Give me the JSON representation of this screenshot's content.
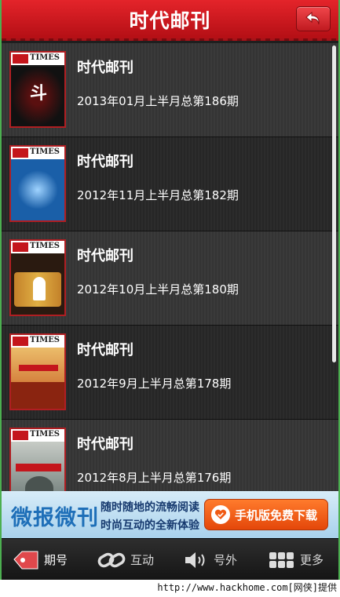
{
  "header": {
    "title": "时代邮刊",
    "back_icon": "back-arrow-icon"
  },
  "issues": [
    {
      "title": "时代邮刊",
      "subtitle": "2013年01月上半月总第186期",
      "cover_glyph": "斗",
      "cover_color": "#1a1a1a"
    },
    {
      "title": "时代邮刊",
      "subtitle": "2012年11月上半月总第182期",
      "cover_glyph": "",
      "cover_color": "#1a5fa8"
    },
    {
      "title": "时代邮刊",
      "subtitle": "2012年10月上半月总第180期",
      "cover_glyph": "",
      "cover_color": "#c3812a"
    },
    {
      "title": "时代邮刊",
      "subtitle": "2012年9月上半月总第178期",
      "cover_glyph": "",
      "cover_color": "#d9a13a"
    },
    {
      "title": "时代邮刊",
      "subtitle": "2012年8月上半月总第176期",
      "cover_glyph": "",
      "cover_color": "#7a8a86"
    }
  ],
  "ad": {
    "brand": "微报微刊",
    "line1": "随时随地的流畅阅读",
    "line2": "时尚互动的全新体验",
    "button": "手机版免费下载"
  },
  "tabs": [
    {
      "label": "期号",
      "icon": "tag-icon"
    },
    {
      "label": "互动",
      "icon": "link-icon"
    },
    {
      "label": "号外",
      "icon": "speaker-icon"
    },
    {
      "label": "更多",
      "icon": "grid-icon"
    }
  ],
  "footer": {
    "text": "http://www.hackhome.com[网侠]提供"
  },
  "colors": {
    "header_red": "#d01a20",
    "ad_button": "#f05a14",
    "background": "#1f1f1f"
  }
}
